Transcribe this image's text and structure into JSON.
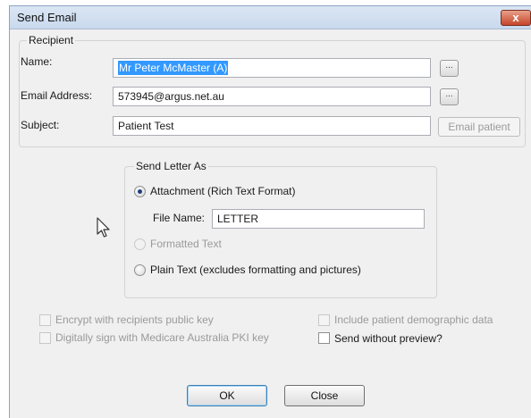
{
  "dialog": {
    "title": "Send Email",
    "close_label": "x"
  },
  "recipient": {
    "group_label": "Recipient",
    "name_label": "Name:",
    "name_value": "Mr Peter McMaster (A)",
    "email_label": "Email Address:",
    "email_value": "573945@argus.net.au",
    "subject_label": "Subject:",
    "subject_value": "Patient Test",
    "browse_label": "...",
    "email_patient_label": "Email patient"
  },
  "send_letter": {
    "group_label": "Send Letter As",
    "attachment_label": "Attachment (Rich Text Format)",
    "attachment_selected": true,
    "file_name_label": "File Name:",
    "file_name_value": "LETTER",
    "formatted_label": "Formatted Text",
    "plain_label": "Plain Text (excludes formatting and pictures)"
  },
  "options": {
    "encrypt_label": "Encrypt with recipients public key",
    "sign_label": "Digitally sign with Medicare Australia PKI key",
    "demographic_label": "Include patient demographic data",
    "no_preview_label": "Send without preview?"
  },
  "buttons": {
    "ok_label": "OK",
    "close_label": "Close"
  }
}
